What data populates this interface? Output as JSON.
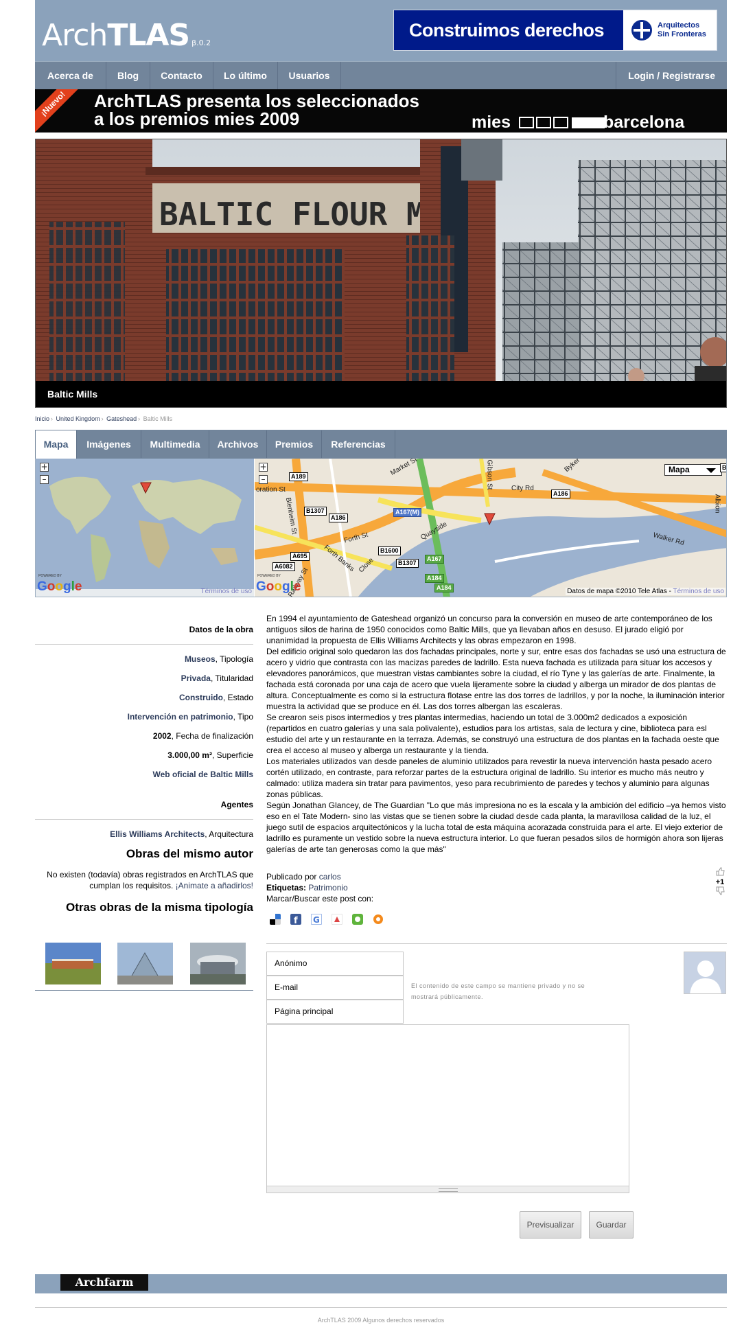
{
  "header": {
    "logo_thin": "Arch",
    "logo_bold": "TLAS",
    "logo_beta": "β.0.2",
    "banner_text": "Construimos derechos",
    "banner_org_line1": "Arquitectos",
    "banner_org_line2": "Sin Fronteras"
  },
  "nav": {
    "items": [
      "Acerca de",
      "Blog",
      "Contacto",
      "Lo último",
      "Usuarios"
    ],
    "login": "Login / Registrarse"
  },
  "promo": {
    "ribbon": "¡Nuevo!",
    "line1": "ArchTLAS presenta los seleccionados",
    "line2": "a los premios mies 2009",
    "brand_left": "mies",
    "brand_right": "barcelona"
  },
  "hero": {
    "caption": "Baltic Mills",
    "sign_text": "BALTIC FLOUR MI"
  },
  "breadcrumb": {
    "items": [
      "Inicio",
      "United Kingdom",
      "Gateshead"
    ],
    "current": "Baltic Mills",
    "separator": "›"
  },
  "tabs": [
    "Mapa",
    "Imágenes",
    "Multimedia",
    "Archivos",
    "Premios",
    "Referencias"
  ],
  "map": {
    "zoom_in": "+",
    "zoom_out": "–",
    "powered_by": "POWERED BY",
    "google": [
      "G",
      "o",
      "o",
      "g",
      "l",
      "e"
    ],
    "terms": "Términos de uso",
    "credit": "Datos de mapa ©2010 Tele Atlas - ",
    "map_type": "Mapa",
    "road_labels": [
      "A189",
      "B1307",
      "A186",
      "A167(M)",
      "A186",
      "B1600",
      "B1307",
      "A167",
      "A184",
      "A695",
      "A6082",
      "A184",
      "B"
    ],
    "streets": [
      "Market St",
      "Gibson St",
      "City Rd",
      "Byker",
      "Walker Rd",
      "Blenheim St",
      "Forth St",
      "Quayside",
      "Forth Banks",
      "Close",
      "Railway St",
      "oration St",
      "Albion"
    ]
  },
  "sidebar": {
    "datos_title": "Datos de la obra",
    "rows": [
      {
        "strong": "Museos",
        "rest": ", Tipología"
      },
      {
        "strong": "Privada",
        "rest": ", Titularidad"
      },
      {
        "strong": "Construido",
        "rest": ", Estado"
      },
      {
        "strong": "Intervención en patrimonio",
        "rest": ", Tipo"
      },
      {
        "strong": "2002",
        "rest": ", Fecha de finalización"
      },
      {
        "strong": "3.000,00 m²",
        "rest": ", Superficie"
      },
      {
        "strong": "Web oficial de Baltic Mills",
        "rest": ""
      }
    ],
    "agentes_title": "Agentes",
    "agente_name": "Ellis Williams Architects",
    "agente_role": ", Arquitectura",
    "same_author_title": "Obras del mismo autor",
    "same_author_text": "No existen (todavía) obras registrados en ArchTLAS que cumplan los requisitos. ",
    "same_author_link": "¡Animate a añadirlos!",
    "same_type_title": "Otras obras de la misma tipología"
  },
  "article": {
    "paragraphs": [
      "En 1994 el ayuntamiento de Gateshead organizó un concurso para la conversión en museo de arte contemporáneo de los antiguos silos de harina de 1950 conocidos como Baltic Mills, que ya llevaban años en desuso. El jurado eligió por unanimidad la propuesta de Ellis Williams Architects y las obras empezaron en 1998.",
      "Del edificio original solo quedaron las dos fachadas principales, norte y sur, entre esas dos fachadas se usó una estructura de acero y vidrio que contrasta con las macizas paredes de ladrillo. Esta nueva fachada es utilizada para situar los accesos y elevadores panorámicos, que muestran vistas cambiantes sobre la ciudad, el río Tyne y las galerías de arte. Finalmente, la fachada está coronada por una caja de acero que vuela lijeramente sobre la ciudad y alberga un mirador de dos plantas de altura. Conceptualmente es como si la estructura flotase entre las dos torres de ladrillos, y por la noche, la iluminación interior muestra la actividad que se produce en él. Las dos torres albergan las escaleras.",
      "Se crearon seis pisos intermedios y tres plantas intermedias, haciendo un total de 3.000m2 dedicados a exposición (repartidos en cuatro galerías y una sala polivalente), estudios para los artistas, sala de lectura y cine, biblioteca para esl estudio del arte y un restaurante en la terraza. Además, se construyó una estructura de dos plantas en la fachada oeste que crea el acceso al museo y alberga un restaurante y la tienda.",
      "Los materiales utilizados van desde paneles de aluminio utilizados para revestir la nueva intervención hasta pesado acero cortén utilizado, en contraste, para reforzar partes de la estructura original de ladrillo. Su interior es mucho más neutro y calmado: utiliza madera sin tratar para pavimentos, yeso para recubrimiento de paredes y techos y aluminio para algunas zonas públicas.",
      "Según Jonathan Glancey, de The Guardian \"Lo que más impresiona no es la escala y la ambición del edificio –ya hemos visto eso en el Tate Modern- sino las vistas que se tienen sobre la ciudad desde cada planta, la maravillosa calidad de la luz, el juego sutil de espacios arquitectónicos y la lucha total de esta máquina acorazada construida para el arte. El viejo exterior de ladrillo es puramente un vestido sobre la nueva estructura interior. Lo que fueran pesados silos de hormigón ahora son lijeras galerías de arte tan generosas como la que más\""
    ],
    "published_label": "Publicado por ",
    "author": "carlos",
    "tags_label": "Etiquetas:",
    "tag": "Patrimonio",
    "bookmark_label": "Marcar/Buscar este post con:",
    "vote_count": "+1"
  },
  "comment_form": {
    "name_field": "Anónimo",
    "email_field": "E-mail",
    "homepage_field": "Página principal",
    "email_hint": "El contenido de este campo se mantiene privado y no se mostrará públicamente.",
    "preview_button": "Previsualizar",
    "save_button": "Guardar"
  },
  "footer": {
    "logo": "Archfarm",
    "copyright": "ArchTLAS 2009 Algunos derechos reservados"
  },
  "colors": {
    "header": "#8ba2bb",
    "nav": "#72859b",
    "link": "#2e3d5c",
    "banner_blue": "#001a8a",
    "ribbon": "#e2401c"
  }
}
